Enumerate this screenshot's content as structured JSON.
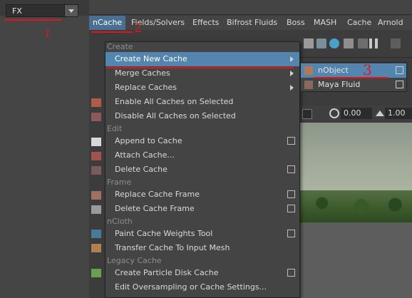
{
  "workspace": {
    "menu_set": "FX"
  },
  "menubar": {
    "items": [
      "nCache",
      "Fields/Solvers",
      "Effects",
      "Bifrost Fluids",
      "Boss",
      "MASH",
      "Cache",
      "Arnold"
    ],
    "active": "nCache"
  },
  "viewport": {
    "field1": "0.00",
    "field2": "1.00"
  },
  "ncache_menu": {
    "sections": [
      "Create",
      "Edit",
      "Frame",
      "nCloth",
      "Legacy Cache"
    ],
    "items": [
      "Create New Cache",
      "Merge Caches",
      "Replace Caches",
      "Enable All Caches on Selected",
      "Disable All Caches on Selected",
      "Append to Cache",
      "Attach Cache...",
      "Delete Cache",
      "Replace Cache Frame",
      "Delete Cache Frame",
      "Paint Cache Weights Tool",
      "Transfer Cache To Input Mesh",
      "Create Particle Disk Cache",
      "Edit Oversampling or Cache Settings..."
    ]
  },
  "submenu": {
    "items": [
      "nObject",
      "Maya Fluid"
    ]
  },
  "annotations": {
    "one": "1",
    "two": "2",
    "three": "3",
    "color": "#e0161d"
  },
  "colors": {
    "highlight": "#5385ae",
    "menu_bg": "#444444",
    "annotation": "#e0161d"
  }
}
